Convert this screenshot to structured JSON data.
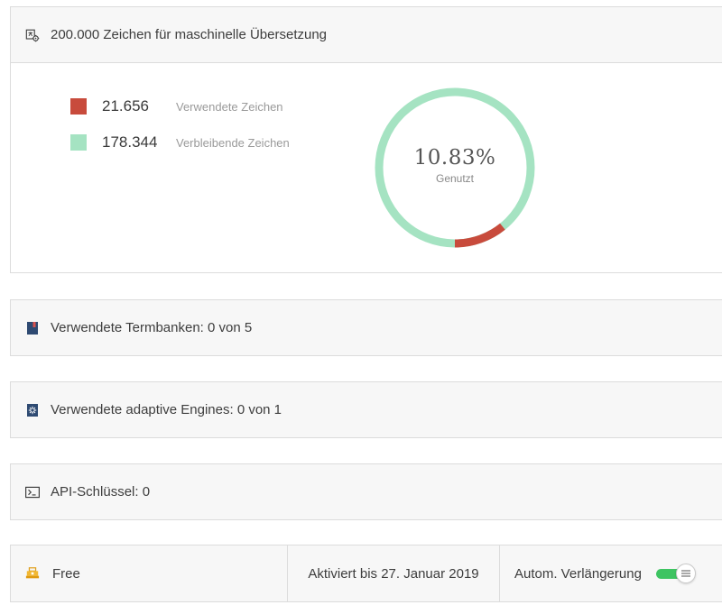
{
  "colors": {
    "used": "#c84b3c",
    "remaining": "#a5e3c2",
    "toggle_on": "#3ec462"
  },
  "usage": {
    "title": "200.000 Zeichen für maschinelle Übersetzung",
    "icon": "translate-gear-icon",
    "used": {
      "value": "21.656",
      "label": "Verwendete Zeichen",
      "amount": 21656
    },
    "remaining": {
      "value": "178.344",
      "label": "Verbleibende Zeichen",
      "amount": 178344
    },
    "percent_label": "10.83%",
    "percent": 10.83,
    "percent_caption": "Genutzt"
  },
  "termbanks": {
    "title": "Verwendete Termbanken: 0 von 5",
    "icon": "book-icon"
  },
  "engines": {
    "title": "Verwendete adaptive Engines: 0 von 1",
    "icon": "engine-icon"
  },
  "api": {
    "title": "API-Schlüssel: 0",
    "icon": "terminal-icon"
  },
  "plan": {
    "name": "Free",
    "icon": "plan-package-icon",
    "active_until": "Aktiviert bis 27. Januar 2019",
    "renewal_label": "Autom. Verlängerung",
    "renewal_on": true
  }
}
